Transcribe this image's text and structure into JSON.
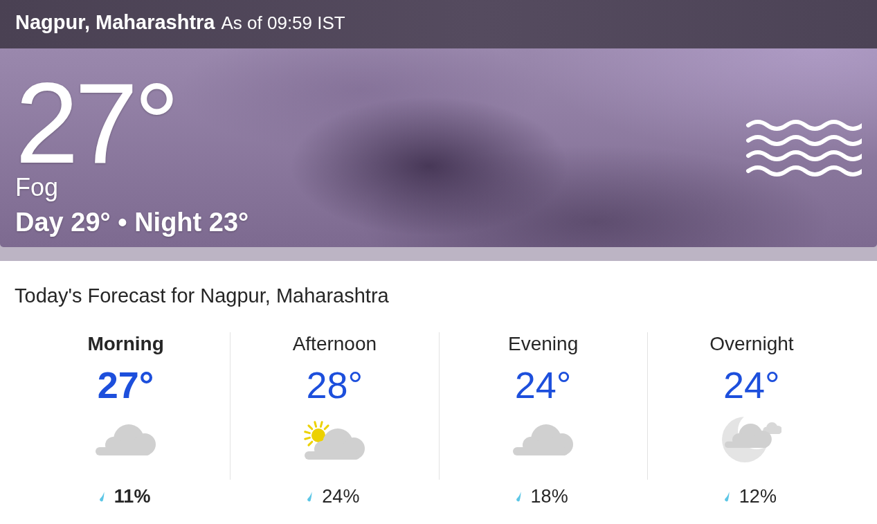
{
  "header": {
    "location": "Nagpur, Maharashtra",
    "updated": "As of 09:59 IST"
  },
  "current": {
    "temperature": "27°",
    "condition": "Fog",
    "day_night": "Day 29° • Night 23°"
  },
  "forecast": {
    "title": "Today's Forecast for Nagpur, Maharashtra",
    "periods": [
      {
        "label": "Morning",
        "temperature": "27°",
        "kind": "cloudy",
        "precipitation": "11%",
        "selected": true
      },
      {
        "label": "Afternoon",
        "temperature": "28°",
        "kind": "partly-sunny",
        "precipitation": "24%",
        "selected": false
      },
      {
        "label": "Evening",
        "temperature": "24°",
        "kind": "cloudy",
        "precipitation": "18%",
        "selected": false
      },
      {
        "label": "Overnight",
        "temperature": "24°",
        "kind": "night-cloudy",
        "precipitation": "12%",
        "selected": false
      }
    ]
  }
}
